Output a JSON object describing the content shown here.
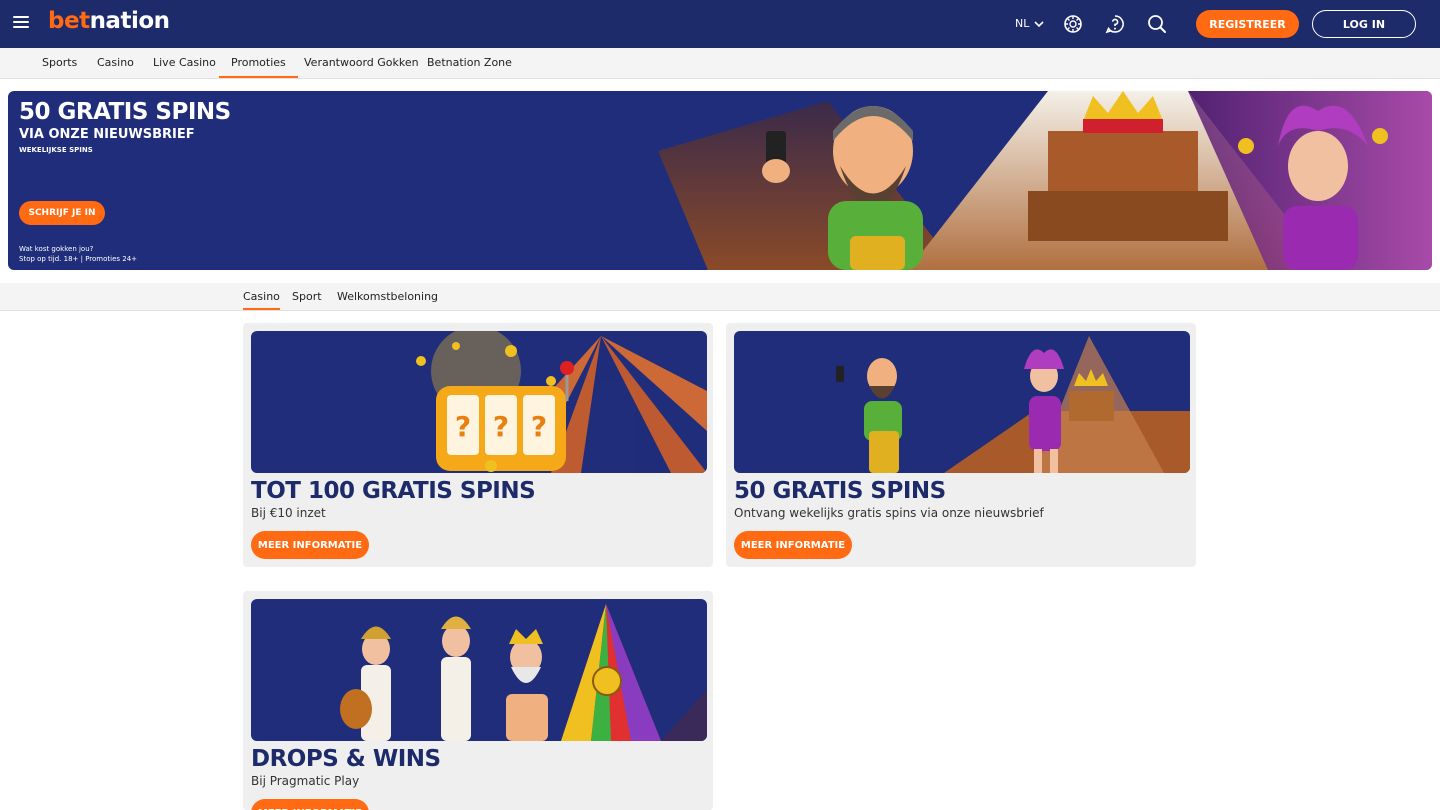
{
  "header": {
    "logo_part1": "bet",
    "logo_part2": "nation",
    "language": "NL",
    "register_label": "REGISTREER",
    "login_label": "LOG IN",
    "icons": [
      "menu-icon",
      "casino-chip-icon",
      "help-icon",
      "search-icon",
      "chevron-down-icon"
    ]
  },
  "subnav": {
    "items": [
      {
        "label": "Sports"
      },
      {
        "label": "Casino"
      },
      {
        "label": "Live Casino"
      },
      {
        "label": "Promoties",
        "active": true
      },
      {
        "label": "Verantwoord Gokken"
      },
      {
        "label": "Betnation Zone"
      }
    ]
  },
  "hero": {
    "title": "50 GRATIS SPINS",
    "subtitle": "VIA ONZE NIEUWSBRIEF",
    "subtitle2": "WEKELIJKSE SPINS",
    "cta_label": "SCHRIJF JE IN",
    "disclaimer_line1": "Wat kost gokken jou?",
    "disclaimer_line2": "Stop op tijd. 18+ | Promoties 24+"
  },
  "tabs": {
    "items": [
      {
        "label": "Casino",
        "active": true
      },
      {
        "label": "Sport"
      },
      {
        "label": "Welkomstbeloning"
      }
    ]
  },
  "promos": [
    {
      "title": "TOT 100 GRATIS SPINS",
      "description": "Bij €10 inzet",
      "button_label": "MEER INFORMATIE"
    },
    {
      "title": "50 GRATIS SPINS",
      "description": "Ontvang wekelijks gratis spins via onze nieuwsbrief",
      "button_label": "MEER INFORMATIE"
    },
    {
      "title": "DROPS & WINS",
      "description": "Bij Pragmatic Play",
      "button_label": "MEER INFORMATIE"
    }
  ],
  "colors": {
    "brand_navy": "#1d2b6a",
    "accent_orange": "#ff6a13",
    "banner_blue": "#1f2d7a"
  }
}
